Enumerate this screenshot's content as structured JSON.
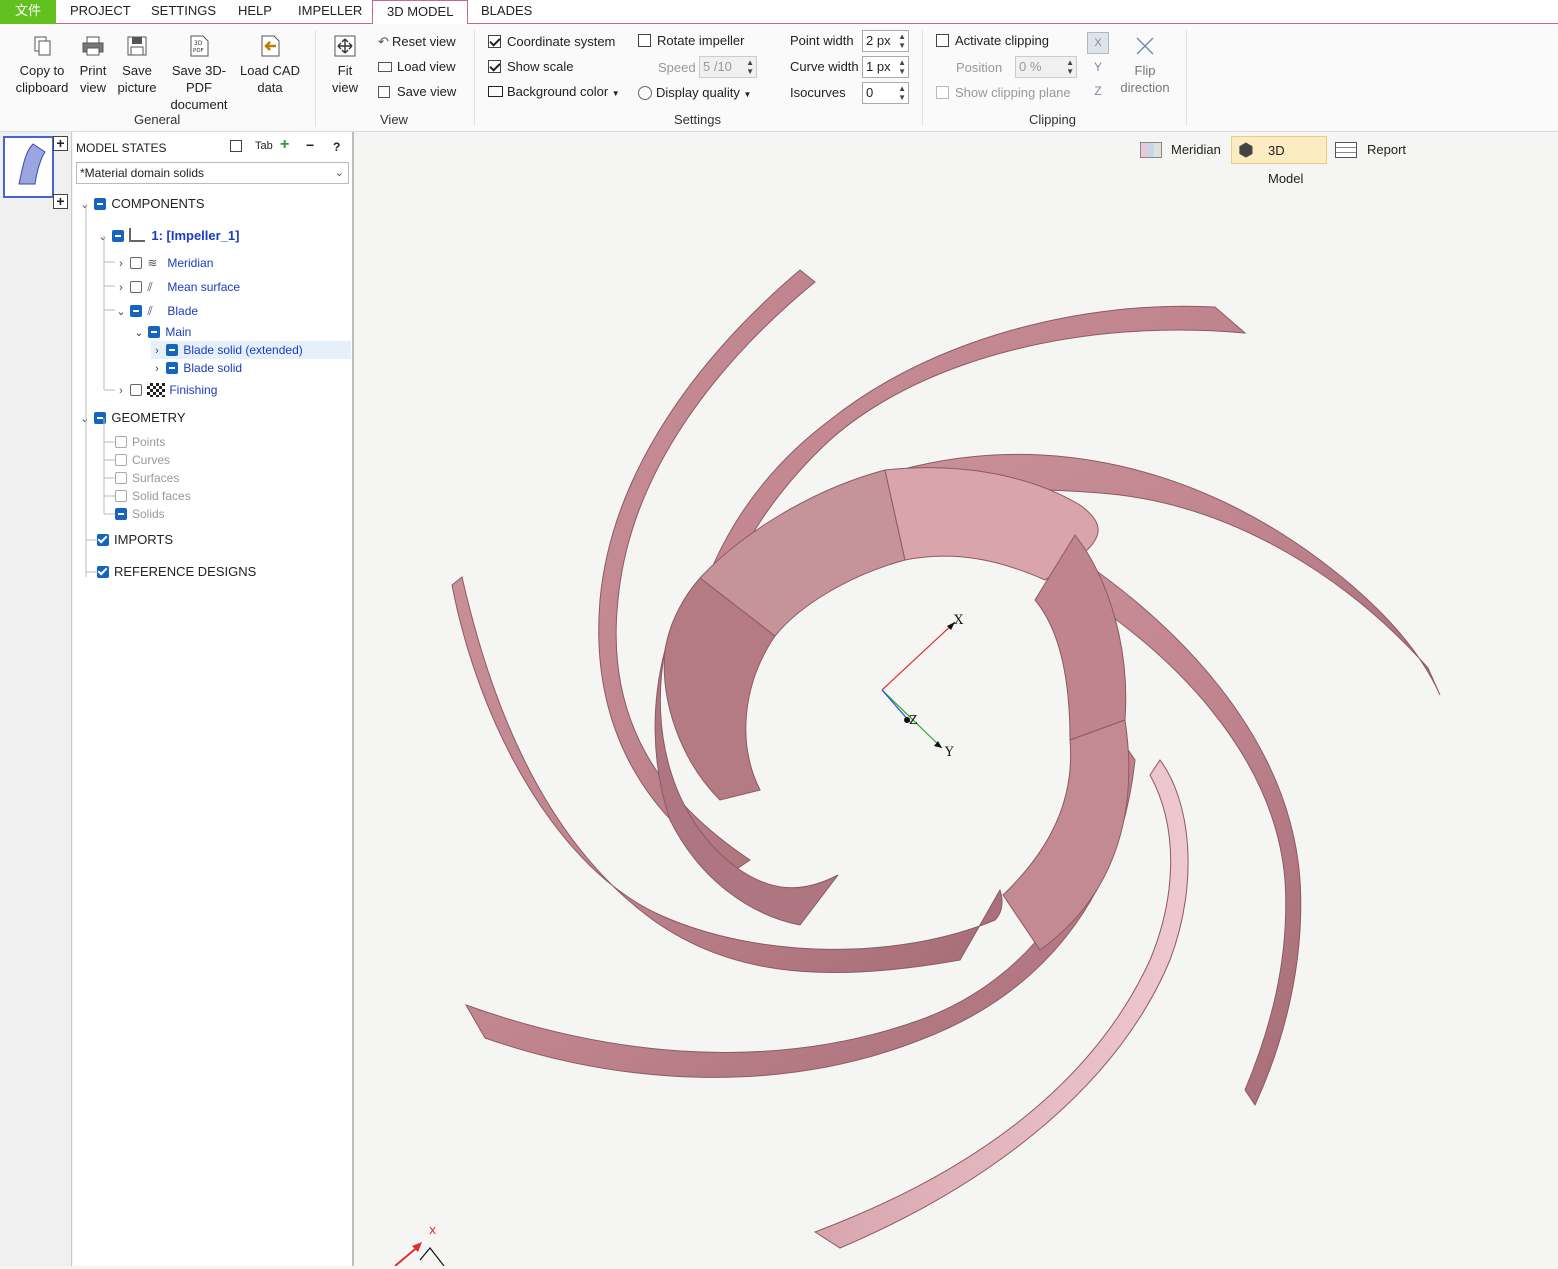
{
  "menu": {
    "file": "文件",
    "project": "PROJECT",
    "settings": "SETTINGS",
    "help": "HELP",
    "impeller": "IMPELLER",
    "model3d": "3D MODEL",
    "blades": "BLADES"
  },
  "ribbon": {
    "general": {
      "copy_l1": "Copy to",
      "copy_l2": "clipboard",
      "print_l1": "Print",
      "print_l2": "view",
      "savepic_l1": "Save",
      "savepic_l2": "picture",
      "pdf_l1": "Save 3D-PDF",
      "pdf_l2": "document",
      "cad_l1": "Load CAD",
      "cad_l2": "data",
      "label": "General"
    },
    "view": {
      "fit_l1": "Fit",
      "fit_l2": "view",
      "reset": "Reset view",
      "load": "Load view",
      "save": "Save view",
      "label": "View"
    },
    "settings": {
      "coord": "Coordinate system",
      "scale": "Show scale",
      "bg": "Background color",
      "rotate": "Rotate impeller",
      "speed_label": "Speed",
      "speed_value": "5 /10",
      "quality": "Display quality",
      "point_width_label": "Point width",
      "point_width_value": "2 px",
      "curve_width_label": "Curve width",
      "curve_width_value": "1 px",
      "isocurves_label": "Isocurves",
      "isocurves_value": "0",
      "label": "Settings"
    },
    "clipping": {
      "activate": "Activate clipping",
      "position_label": "Position",
      "position_value": "0 %",
      "show_plane": "Show clipping plane",
      "flip_l1": "Flip",
      "flip_l2": "direction",
      "label": "Clipping"
    }
  },
  "panel": {
    "title": "MODEL STATES",
    "tab_icon": "Tab",
    "help": "?",
    "state": "*Material domain solids",
    "tree": {
      "components": "COMPONENTS",
      "impeller": "1: [Impeller_1]",
      "meridian": "Meridian",
      "mean_surface": "Mean surface",
      "blade": "Blade",
      "main": "Main",
      "blade_solid_ext": "Blade solid (extended)",
      "blade_solid": "Blade solid",
      "finishing": "Finishing",
      "geometry": "GEOMETRY",
      "points": "Points",
      "curves": "Curves",
      "surfaces": "Surfaces",
      "solid_faces": "Solid faces",
      "solids": "Solids",
      "imports": "IMPORTS",
      "reference": "REFERENCE DESIGNS"
    }
  },
  "view_tabs": {
    "meridian": "Meridian",
    "model3d": "3D Model",
    "report": "Report"
  },
  "axes": {
    "x": "X",
    "y": "Y",
    "z": "Z",
    "corner_x": "x"
  },
  "colors": {
    "blade_fill": "#c0848f",
    "blade_light": "#e3b4bd",
    "blade_dark": "#8c5a63",
    "accent": "#c8649a",
    "file_tab": "#63c021",
    "active_view_tab": "#fcecc2"
  }
}
